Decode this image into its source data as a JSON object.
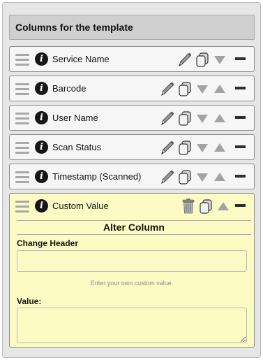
{
  "header": {
    "title": "Columns for the template"
  },
  "rows": [
    {
      "label": "Service Name"
    },
    {
      "label": "Barcode"
    },
    {
      "label": "User Name"
    },
    {
      "label": "Scan Status"
    },
    {
      "label": "Timestamp (Scanned)"
    },
    {
      "label": "Custom Value"
    }
  ],
  "alter": {
    "title": "Alter Column",
    "change_header_label": "Change Header",
    "change_header_value": "",
    "hint": "Enter your own custom value.",
    "value_label": "Value:",
    "value_value": ""
  },
  "colors": {
    "expanded_row_bg": "#fdfbc4",
    "header_bg": "#cfcfcf",
    "panel_bg": "#e6e6e6"
  },
  "icons": [
    "drag-handle-icon",
    "info-icon",
    "pencil-icon",
    "copy-icon",
    "move-down-icon",
    "move-up-icon",
    "collapse-icon",
    "trash-icon"
  ]
}
